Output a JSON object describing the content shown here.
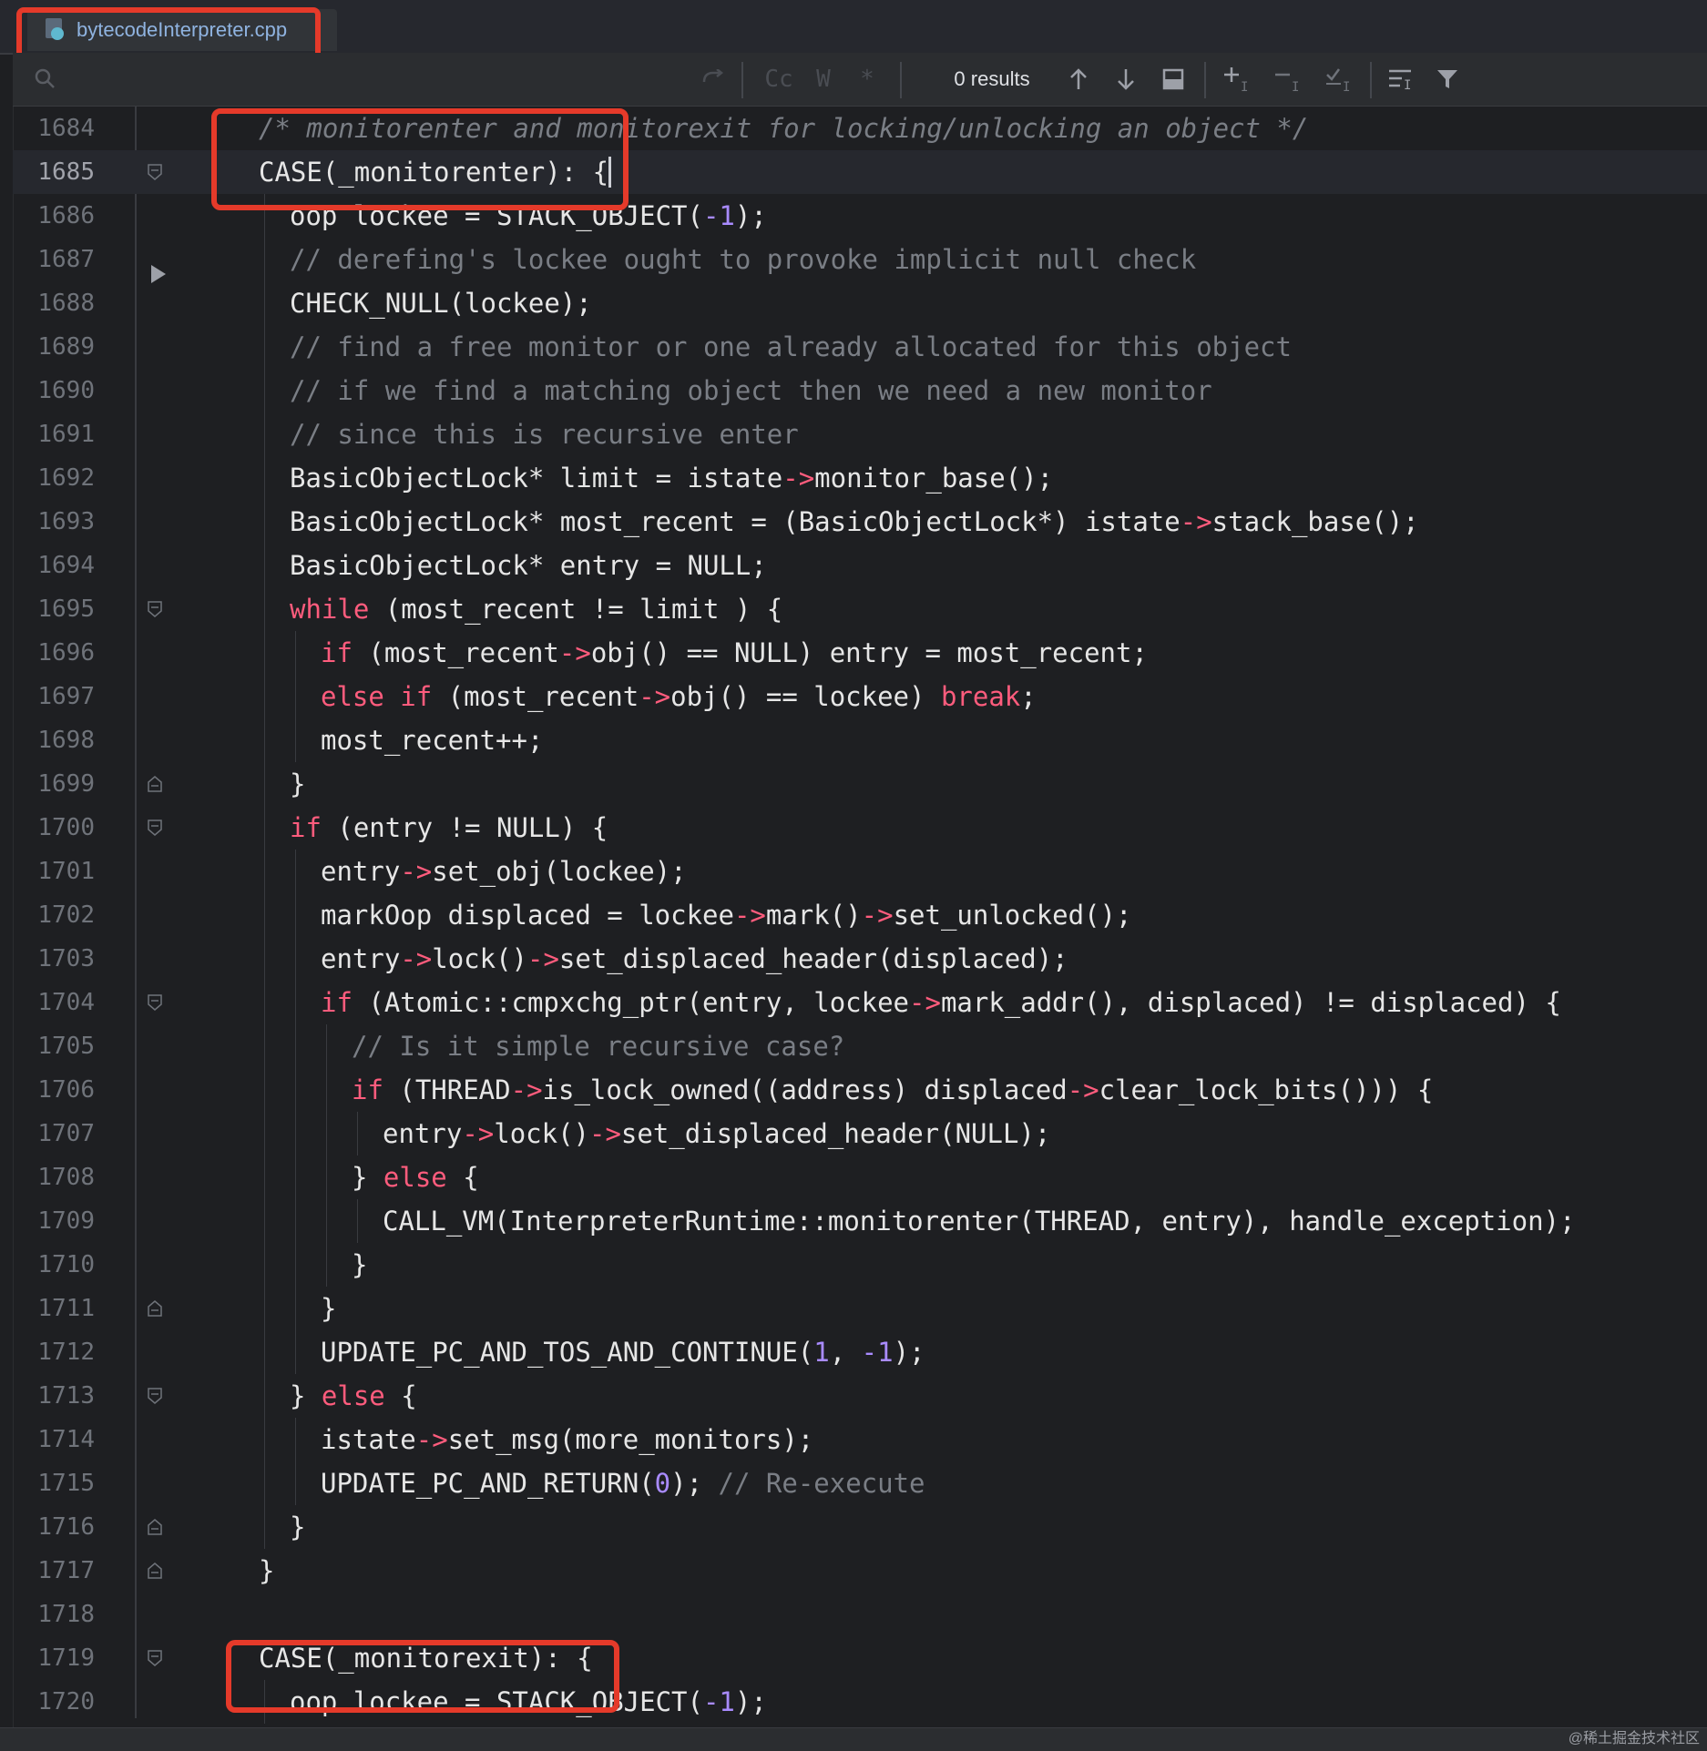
{
  "tab": {
    "filename": "bytecodeInterpreter.cpp"
  },
  "find": {
    "results_label": "0 results",
    "match_case_label": "Cc",
    "words_label": "W",
    "regex_label": "*"
  },
  "colors": {
    "keyword": "#ff5c7d",
    "comment": "#7a7e85",
    "number": "#a98bff",
    "arrow": "#ff5c7d",
    "plain": "#e6e6e6",
    "highlight": "#e53a2a"
  },
  "editor": {
    "lines": [
      {
        "n": "1684",
        "indent": 0,
        "tokens": [
          [
            "c",
            "/* monitorenter and monitorexit for locking/unlocking an object */"
          ]
        ]
      },
      {
        "n": "1685",
        "indent": 0,
        "current": true,
        "tokens": [
          [
            "p",
            "CASE(_monitorenter): {"
          ]
        ]
      },
      {
        "n": "1686",
        "indent": 1,
        "tokens": [
          [
            "p",
            "oop lockee = STACK_OBJECT("
          ],
          [
            "num",
            "-1"
          ],
          [
            "p",
            ");"
          ]
        ]
      },
      {
        "n": "1687",
        "indent": 1,
        "tokens": [
          [
            "c",
            "// derefing's lockee ought to provoke implicit null check"
          ]
        ]
      },
      {
        "n": "1688",
        "indent": 1,
        "tokens": [
          [
            "p",
            "CHECK_NULL(lockee);"
          ]
        ]
      },
      {
        "n": "1689",
        "indent": 1,
        "tokens": [
          [
            "c",
            "// find a free monitor or one already allocated for this object"
          ]
        ]
      },
      {
        "n": "1690",
        "indent": 1,
        "tokens": [
          [
            "c",
            "// if we find a matching object then we need a new monitor"
          ]
        ]
      },
      {
        "n": "1691",
        "indent": 1,
        "tokens": [
          [
            "c",
            "// since this is recursive enter"
          ]
        ]
      },
      {
        "n": "1692",
        "indent": 1,
        "tokens": [
          [
            "p",
            "BasicObjectLock* limit = istate"
          ],
          [
            "a",
            "->"
          ],
          [
            "p",
            "monitor_base();"
          ]
        ]
      },
      {
        "n": "1693",
        "indent": 1,
        "tokens": [
          [
            "p",
            "BasicObjectLock* most_recent = (BasicObjectLock*) istate"
          ],
          [
            "a",
            "->"
          ],
          [
            "p",
            "stack_base();"
          ]
        ]
      },
      {
        "n": "1694",
        "indent": 1,
        "tokens": [
          [
            "p",
            "BasicObjectLock* entry = NULL;"
          ]
        ]
      },
      {
        "n": "1695",
        "indent": 1,
        "tokens": [
          [
            "k",
            "while"
          ],
          [
            "p",
            " (most_recent != limit ) {"
          ]
        ]
      },
      {
        "n": "1696",
        "indent": 2,
        "tokens": [
          [
            "k",
            "if"
          ],
          [
            "p",
            " (most_recent"
          ],
          [
            "a",
            "->"
          ],
          [
            "p",
            "obj() == NULL) entry = most_recent;"
          ]
        ]
      },
      {
        "n": "1697",
        "indent": 2,
        "tokens": [
          [
            "k",
            "else if"
          ],
          [
            "p",
            " (most_recent"
          ],
          [
            "a",
            "->"
          ],
          [
            "p",
            "obj() == lockee) "
          ],
          [
            "k",
            "break"
          ],
          [
            "p",
            ";"
          ]
        ]
      },
      {
        "n": "1698",
        "indent": 2,
        "tokens": [
          [
            "p",
            "most_recent++;"
          ]
        ]
      },
      {
        "n": "1699",
        "indent": 1,
        "tokens": [
          [
            "p",
            "}"
          ]
        ]
      },
      {
        "n": "1700",
        "indent": 1,
        "tokens": [
          [
            "k",
            "if"
          ],
          [
            "p",
            " (entry != NULL) {"
          ]
        ]
      },
      {
        "n": "1701",
        "indent": 2,
        "tokens": [
          [
            "p",
            "entry"
          ],
          [
            "a",
            "->"
          ],
          [
            "p",
            "set_obj(lockee);"
          ]
        ]
      },
      {
        "n": "1702",
        "indent": 2,
        "tokens": [
          [
            "p",
            "markOop displaced = lockee"
          ],
          [
            "a",
            "->"
          ],
          [
            "p",
            "mark()"
          ],
          [
            "a",
            "->"
          ],
          [
            "p",
            "set_unlocked();"
          ]
        ]
      },
      {
        "n": "1703",
        "indent": 2,
        "tokens": [
          [
            "p",
            "entry"
          ],
          [
            "a",
            "->"
          ],
          [
            "p",
            "lock()"
          ],
          [
            "a",
            "->"
          ],
          [
            "p",
            "set_displaced_header(displaced);"
          ]
        ]
      },
      {
        "n": "1704",
        "indent": 2,
        "tokens": [
          [
            "k",
            "if"
          ],
          [
            "p",
            " (Atomic::cmpxchg_ptr(entry, lockee"
          ],
          [
            "a",
            "->"
          ],
          [
            "p",
            "mark_addr(), displaced) != displaced) {"
          ]
        ]
      },
      {
        "n": "1705",
        "indent": 3,
        "tokens": [
          [
            "c",
            "// Is it simple recursive case?"
          ]
        ]
      },
      {
        "n": "1706",
        "indent": 3,
        "tokens": [
          [
            "k",
            "if"
          ],
          [
            "p",
            " (THREAD"
          ],
          [
            "a",
            "->"
          ],
          [
            "p",
            "is_lock_owned((address) displaced"
          ],
          [
            "a",
            "->"
          ],
          [
            "p",
            "clear_lock_bits())) {"
          ]
        ]
      },
      {
        "n": "1707",
        "indent": 4,
        "tokens": [
          [
            "p",
            "entry"
          ],
          [
            "a",
            "->"
          ],
          [
            "p",
            "lock()"
          ],
          [
            "a",
            "->"
          ],
          [
            "p",
            "set_displaced_header(NULL);"
          ]
        ]
      },
      {
        "n": "1708",
        "indent": 3,
        "tokens": [
          [
            "p",
            "} "
          ],
          [
            "k",
            "else"
          ],
          [
            "p",
            " {"
          ]
        ]
      },
      {
        "n": "1709",
        "indent": 4,
        "tokens": [
          [
            "p",
            "CALL_VM(InterpreterRuntime::monitorenter(THREAD, entry), handle_exception);"
          ]
        ]
      },
      {
        "n": "1710",
        "indent": 3,
        "tokens": [
          [
            "p",
            "}"
          ]
        ]
      },
      {
        "n": "1711",
        "indent": 2,
        "tokens": [
          [
            "p",
            "}"
          ]
        ]
      },
      {
        "n": "1712",
        "indent": 2,
        "tokens": [
          [
            "p",
            "UPDATE_PC_AND_TOS_AND_CONTINUE("
          ],
          [
            "num",
            "1"
          ],
          [
            "p",
            ", "
          ],
          [
            "num",
            "-1"
          ],
          [
            "p",
            ");"
          ]
        ]
      },
      {
        "n": "1713",
        "indent": 1,
        "tokens": [
          [
            "p",
            "} "
          ],
          [
            "k",
            "else"
          ],
          [
            "p",
            " {"
          ]
        ]
      },
      {
        "n": "1714",
        "indent": 2,
        "tokens": [
          [
            "p",
            "istate"
          ],
          [
            "a",
            "->"
          ],
          [
            "p",
            "set_msg(more_monitors);"
          ]
        ]
      },
      {
        "n": "1715",
        "indent": 2,
        "tokens": [
          [
            "p",
            "UPDATE_PC_AND_RETURN("
          ],
          [
            "num",
            "0"
          ],
          [
            "p",
            "); "
          ],
          [
            "c",
            "// Re-execute"
          ]
        ]
      },
      {
        "n": "1716",
        "indent": 1,
        "tokens": [
          [
            "p",
            "}"
          ]
        ]
      },
      {
        "n": "1717",
        "indent": 0,
        "tokens": [
          [
            "p",
            "}"
          ]
        ]
      },
      {
        "n": "1718",
        "indent": 0,
        "tokens": []
      },
      {
        "n": "1719",
        "indent": 0,
        "tokens": [
          [
            "p",
            "CASE(_monitorexit): {"
          ]
        ]
      },
      {
        "n": "1720",
        "indent": 1,
        "tokens": [
          [
            "p",
            "oop lockee = STACK_OBJECT("
          ],
          [
            "num",
            "-1"
          ],
          [
            "p",
            ");"
          ]
        ]
      }
    ]
  },
  "watermark": "@稀土掘金技术社区"
}
